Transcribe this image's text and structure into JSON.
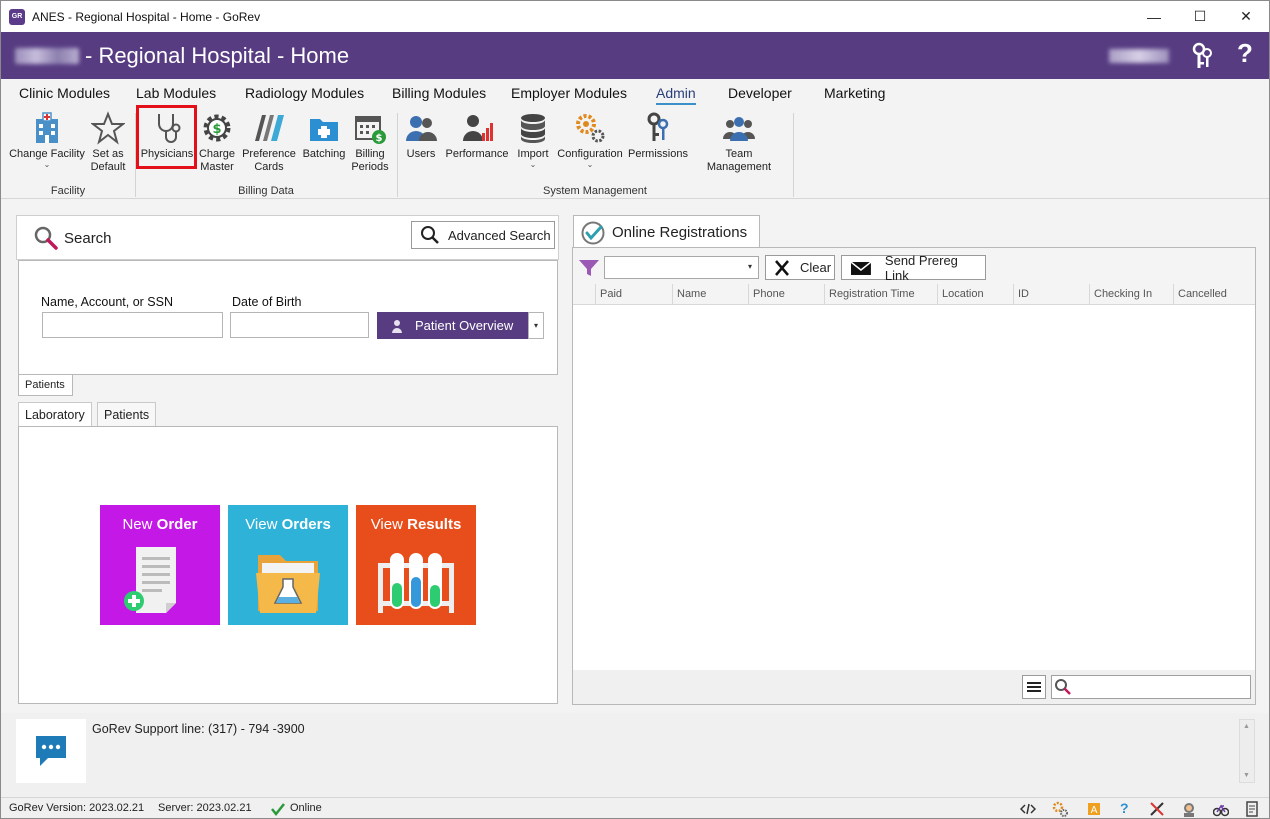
{
  "window": {
    "title": "ANES - Regional Hospital - Home - GoRev",
    "controls": {
      "minimize": "—",
      "maximize": "☐",
      "close": "✕"
    }
  },
  "header": {
    "title": "- Regional Hospital - Home",
    "help": "?"
  },
  "menu_tabs": [
    "Clinic Modules",
    "Lab Modules",
    "Radiology Modules",
    "Billing Modules",
    "Employer Modules",
    "Admin",
    "Developer",
    "Marketing"
  ],
  "active_menu_tab": "Admin",
  "ribbon": {
    "facility": {
      "group_label": "Facility",
      "change_facility": "Change Facility",
      "set_default_1": "Set as",
      "set_default_2": "Default"
    },
    "billing_data": {
      "group_label": "Billing Data",
      "physicians": "Physicians",
      "charge_master_1": "Charge",
      "charge_master_2": "Master",
      "preference_cards_1": "Preference",
      "preference_cards_2": "Cards",
      "batching": "Batching",
      "billing_periods_1": "Billing",
      "billing_periods_2": "Periods"
    },
    "system_management": {
      "group_label": "System Management",
      "users": "Users",
      "performance": "Performance",
      "import": "Import",
      "configuration": "Configuration",
      "permissions": "Permissions",
      "team_management": "Team Management"
    }
  },
  "search": {
    "title": "Search",
    "advanced_search": "Advanced Search",
    "name_label": "Name, Account, or SSN",
    "dob_label": "Date of Birth",
    "name_value": "",
    "dob_value": "",
    "patient_overview": "Patient Overview",
    "bottom_tab": "Patients"
  },
  "lower_tabs": [
    "Laboratory",
    "Patients"
  ],
  "tiles": {
    "new_order": {
      "light": "New ",
      "bold": "Order",
      "color": "#c318e6"
    },
    "view_orders": {
      "light": "View ",
      "bold": "Orders",
      "color": "#2fb2d7"
    },
    "view_results": {
      "light": "View ",
      "bold": "Results",
      "color": "#e84e1b"
    }
  },
  "online_registrations": {
    "title": "Online Registrations",
    "filter_value": "",
    "clear": "Clear",
    "send_prereg": "Send Prereg Link",
    "columns": [
      "Paid",
      "Name",
      "Phone",
      "Registration Time",
      "Location",
      "ID",
      "Checking In",
      "Cancelled"
    ],
    "rows": [],
    "search_value": ""
  },
  "support": {
    "text": "GoRev Support line: (317) - 794 -3900"
  },
  "status": {
    "version": "GoRev Version: 2023.02.21",
    "server": "Server: 2023.02.21",
    "online": "Online"
  },
  "colors": {
    "brand_purple": "#573c82",
    "highlight_red": "#e3101a",
    "accent_blue": "#3d8fc9"
  }
}
